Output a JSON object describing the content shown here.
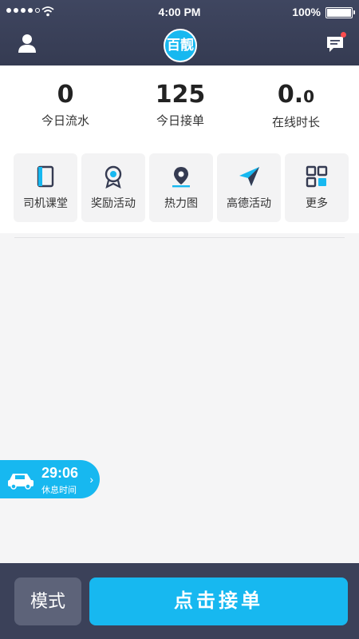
{
  "status": {
    "time": "4:00 PM",
    "battery": "100%"
  },
  "header": {
    "logo_text": "百靓"
  },
  "stats": [
    {
      "value": "0",
      "label": "今日流水"
    },
    {
      "value": "125",
      "label": "今日接单"
    },
    {
      "value_main": "0.",
      "value_small": "0",
      "label": "在线时长"
    }
  ],
  "tools": [
    {
      "label": "司机课堂",
      "icon": "book-icon"
    },
    {
      "label": "奖励活动",
      "icon": "medal-icon"
    },
    {
      "label": "热力图",
      "icon": "location-pin-icon"
    },
    {
      "label": "高德活动",
      "icon": "paper-plane-icon"
    },
    {
      "label": "更多",
      "icon": "grid-icon"
    }
  ],
  "rest": {
    "time": "29:06",
    "label": "休息时间"
  },
  "bottom": {
    "mode_label": "模式",
    "go_label": "点击接单"
  },
  "colors": {
    "header": "#3f4660",
    "accent": "#17b8f0",
    "bottom_bar": "#3b4159",
    "mode_button": "#5d6379"
  }
}
